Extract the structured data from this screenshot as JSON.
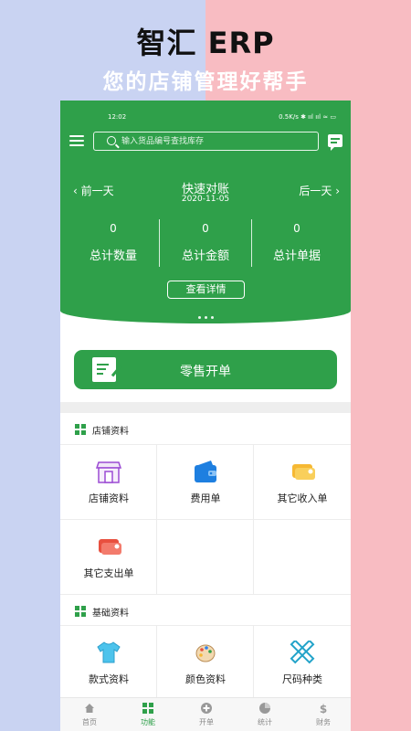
{
  "hero": {
    "title": "智汇 ERP",
    "subtitle": "您的店铺管理好帮手"
  },
  "status_bar": {
    "time": "12:02",
    "right": "0.5K/s ✱ ııl ııl ≈ ▭"
  },
  "search": {
    "placeholder": "输入货品编号查找库存"
  },
  "quick": {
    "prev_label": "‹  前一天",
    "next_label": "后一天  ›",
    "title": "快速对账",
    "date": "2020-11-05",
    "stats": [
      {
        "value": "0",
        "label": "总计数量"
      },
      {
        "value": "0",
        "label": "总计金额"
      },
      {
        "value": "0",
        "label": "总计单据"
      }
    ],
    "detail_button": "查看详情"
  },
  "retail_button": "零售开单",
  "sections": [
    {
      "title": "店铺资料",
      "items": [
        "店铺资料",
        "费用单",
        "其它收入单",
        "其它支出单"
      ]
    },
    {
      "title": "基础资料",
      "items": [
        "款式资料",
        "颜色资料",
        "尺码种类"
      ]
    }
  ],
  "bottom_nav": [
    {
      "label": "首页",
      "icon": "home-icon",
      "active": false
    },
    {
      "label": "功能",
      "icon": "grid-icon",
      "active": true
    },
    {
      "label": "开单",
      "icon": "add-circle-icon",
      "active": false
    },
    {
      "label": "统计",
      "icon": "pie-chart-icon",
      "active": false
    },
    {
      "label": "财务",
      "icon": "dollar-icon",
      "active": false
    }
  ],
  "colors": {
    "primary": "#2fa04a",
    "left_bg": "#c9d3f2",
    "right_bg": "#f8bcc2"
  }
}
